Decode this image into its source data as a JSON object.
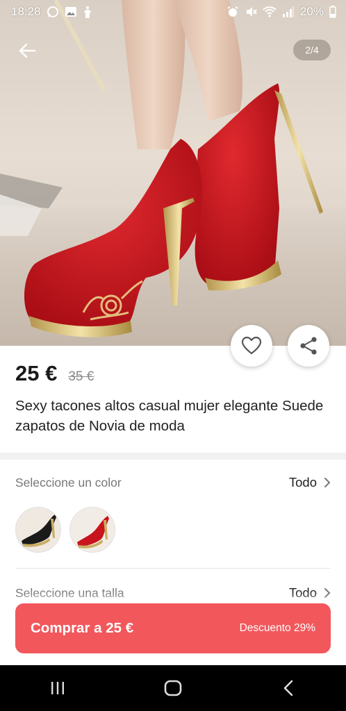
{
  "status_bar": {
    "time": "18:28",
    "battery": "20%",
    "icons": [
      "whatsapp-icon",
      "gallery-icon",
      "accessibility-icon",
      "alarm-icon",
      "mute-icon",
      "wifi-icon",
      "signal-icon",
      "battery-icon"
    ]
  },
  "gallery": {
    "page_indicator": "2/4"
  },
  "product": {
    "price": "25 €",
    "old_price": "35 €",
    "title": "Sexy tacones altos casual mujer elegante Suede zapatos de Novia de moda"
  },
  "options": {
    "color": {
      "label": "Seleccione un color",
      "action": "Todo",
      "swatches": [
        "black",
        "red"
      ]
    },
    "size": {
      "label": "Seleccione una talla",
      "action": "Todo"
    }
  },
  "buy": {
    "label": "Comprar a 25 €",
    "discount": "Descuento 29%"
  },
  "colors": {
    "accent": "#f2575c",
    "shoe_red": "#c8141d",
    "nav_bg": "#000000"
  }
}
